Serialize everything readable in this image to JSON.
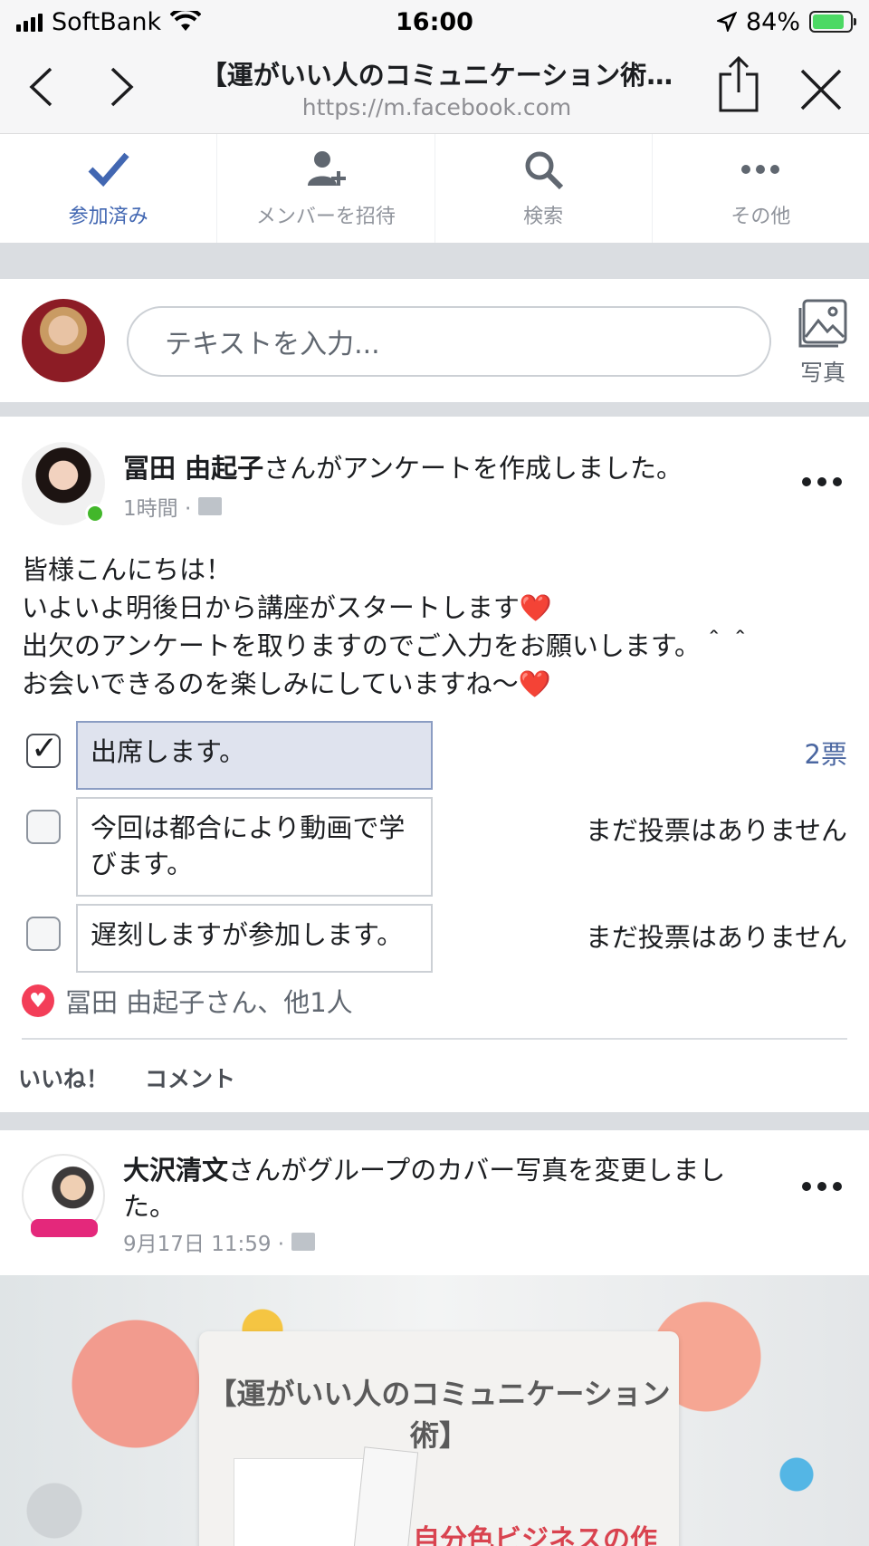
{
  "status_bar": {
    "carrier": "SoftBank",
    "time": "16:00",
    "battery": "84%"
  },
  "browser": {
    "title": "【運がいい人のコミュニケーション術…",
    "url": "https://m.facebook.com"
  },
  "group_actions": [
    {
      "label": "参加済み",
      "icon": "check-icon"
    },
    {
      "label": "メンバーを招待",
      "icon": "add-person-icon"
    },
    {
      "label": "検索",
      "icon": "search-icon"
    },
    {
      "label": "その他",
      "icon": "more-icon"
    }
  ],
  "composer": {
    "placeholder": "テキストを入力...",
    "photo_label": "写真"
  },
  "post1": {
    "author": "冨田 由起子",
    "action": "さんがアンケートを作成しました。",
    "time": "1時間 ·",
    "lines": [
      "皆様こんにちは！",
      "いよいよ明後日から講座がスタートします❤️",
      "出欠のアンケートを取りますのでご入力をお願いします。＾＾",
      "お会いできるのを楽しみにしていますね〜❤️"
    ],
    "poll": [
      {
        "text": "出席します。",
        "votes": "2票",
        "checked": true
      },
      {
        "text": "今回は都合により動画で学びます。",
        "votes": "まだ投票はありません",
        "checked": false
      },
      {
        "text": "遅刻しますが参加します。",
        "votes": "まだ投票はありません",
        "checked": false
      }
    ],
    "reactions": "冨田 由起子さん、他1人",
    "like": "いいね！",
    "comment": "コメント"
  },
  "post2": {
    "author": "大沢清文",
    "action": "さんがグループのカバー写真を変更しました。",
    "time": "9月17日 11:59 ·",
    "cover_title": "【運がいい人のコミュニケーション術】",
    "cover_subtitle": "自分色ビジネスの作り方"
  },
  "colors": {
    "accent": "#4267b2",
    "reaction": "#f33e58",
    "online": "#42b72a"
  }
}
